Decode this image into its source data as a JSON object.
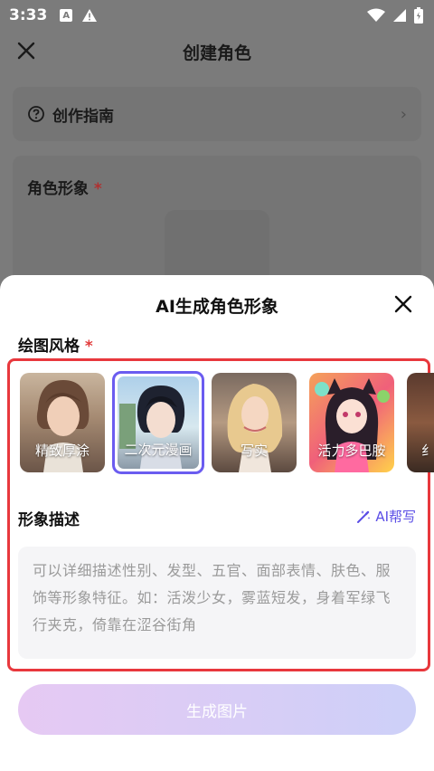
{
  "status_bar": {
    "time": "3:33",
    "icons": [
      "text-a-icon",
      "warning-icon",
      "wifi-icon",
      "signal-icon",
      "battery-icon"
    ]
  },
  "background_page": {
    "title": "创建角色",
    "guide_label": "创作指南",
    "character_image_label": "角色形象",
    "required_mark": "*"
  },
  "sheet": {
    "title": "AI生成角色形象",
    "draw_style_label": "绘图风格",
    "required_mark": "*",
    "styles": [
      {
        "label": "精致厚涂",
        "selected": false
      },
      {
        "label": "二次元漫画",
        "selected": true
      },
      {
        "label": "写实",
        "selected": false
      },
      {
        "label": "活力多巴胺",
        "selected": false
      },
      {
        "label": "纟",
        "selected": false
      }
    ],
    "description_label": "形象描述",
    "ai_help_label": "AI帮写",
    "description_placeholder": "可以详细描述性别、发型、五官、面部表情、肤色、服饰等形象特征。如：活泼少女，雾蓝短发，身着军绿飞行夹克，倚靠在涩谷街角",
    "generate_button": "生成图片"
  },
  "colors": {
    "accent": "#6b5cf0",
    "highlight_border": "#e8383d",
    "required": "#e23b3b",
    "button_gradient_start": "#e6c9f3",
    "button_gradient_end": "#cdd0f8"
  }
}
